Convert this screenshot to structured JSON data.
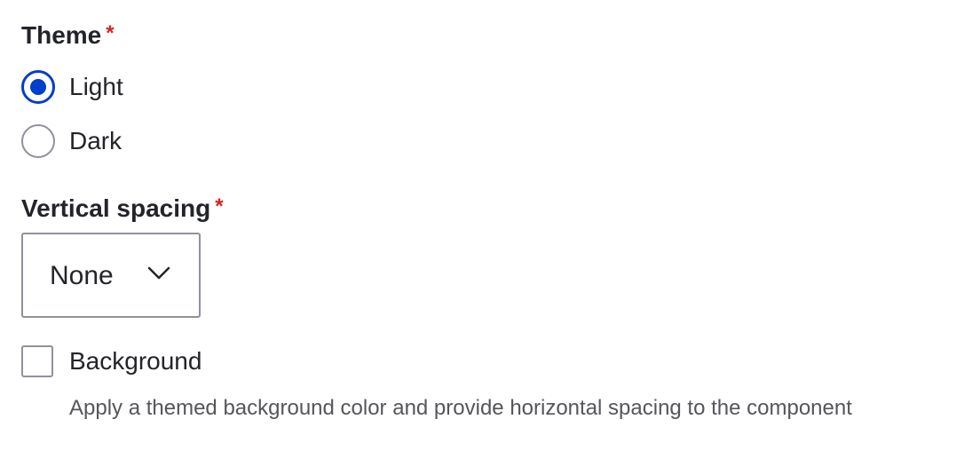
{
  "theme": {
    "label": "Theme",
    "required_marker": "*",
    "options": [
      {
        "label": "Light",
        "checked": true
      },
      {
        "label": "Dark",
        "checked": false
      }
    ]
  },
  "vertical_spacing": {
    "label": "Vertical spacing",
    "required_marker": "*",
    "selected_value": "None"
  },
  "background": {
    "label": "Background",
    "checked": false,
    "description": "Apply a themed background color and provide horizontal spacing to the component"
  },
  "colors": {
    "accent": "#003ecc",
    "required": "#d72222",
    "border": "#8e929c",
    "text": "#232429",
    "description_text": "#55565b"
  },
  "icons": {
    "select_chevron": "chevron-down-icon"
  }
}
